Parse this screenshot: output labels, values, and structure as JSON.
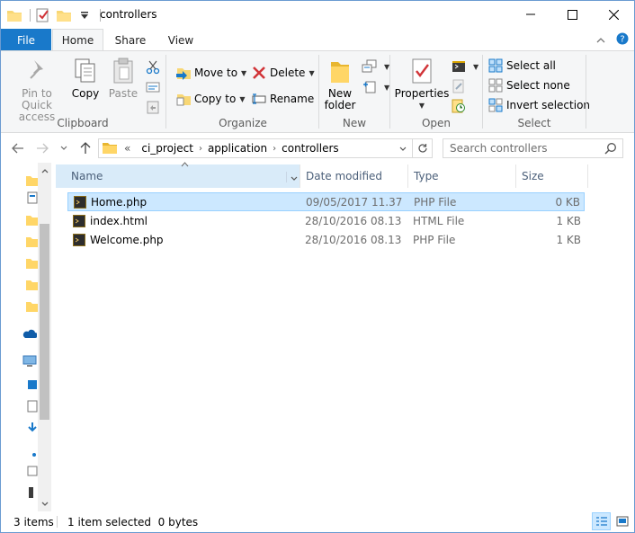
{
  "window": {
    "title": "controllers",
    "icons": {
      "folder": "folder-icon",
      "properties": "properties-icon",
      "new_folder": "new-folder-icon"
    }
  },
  "ribbon_tabs": {
    "file": "File",
    "home": "Home",
    "share": "Share",
    "view": "View"
  },
  "ribbon": {
    "clipboard": {
      "pin_line1": "Pin to Quick",
      "pin_line2": "access",
      "copy": "Copy",
      "paste": "Paste",
      "label": "Clipboard"
    },
    "organize": {
      "move_to": "Move to",
      "copy_to": "Copy to",
      "delete": "Delete",
      "rename": "Rename",
      "label": "Organize"
    },
    "new": {
      "new_folder_line1": "New",
      "new_folder_line2": "folder",
      "label": "New"
    },
    "open": {
      "properties": "Properties",
      "label": "Open"
    },
    "select": {
      "select_all": "Select all",
      "select_none": "Select none",
      "invert": "Invert selection",
      "label": "Select"
    }
  },
  "address": {
    "overflow": "«",
    "crumbs": [
      "ci_project",
      "application",
      "controllers"
    ],
    "search_placeholder": "Search controllers"
  },
  "columns": {
    "name": "Name",
    "date": "Date modified",
    "type": "Type",
    "size": "Size"
  },
  "files": [
    {
      "name": "Home.php",
      "date": "09/05/2017 11.37",
      "type": "PHP File",
      "size": "0 KB",
      "selected": true
    },
    {
      "name": "index.html",
      "date": "28/10/2016 08.13",
      "type": "HTML File",
      "size": "1 KB",
      "selected": false
    },
    {
      "name": "Welcome.php",
      "date": "28/10/2016 08.13",
      "type": "PHP File",
      "size": "1 KB",
      "selected": false
    }
  ],
  "status": {
    "count": "3 items",
    "selection": "1 item selected  0 bytes"
  },
  "colors": {
    "accent": "#1979ca",
    "selection": "#cce8ff",
    "selection_border": "#99d1ff"
  }
}
